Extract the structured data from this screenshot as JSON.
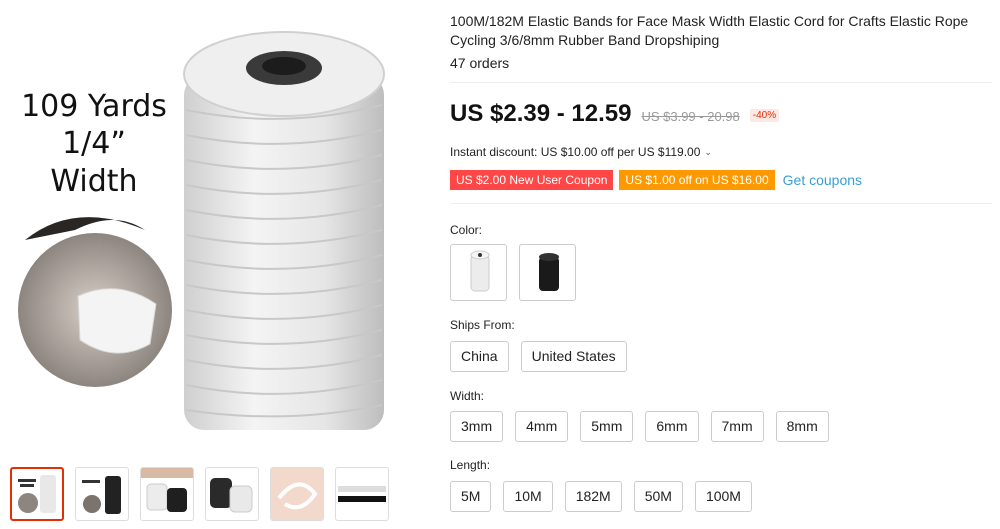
{
  "gallery": {
    "overlay_line1": "109 Yards",
    "overlay_line2": "1/4”  Width",
    "thumbnails": [
      "thumb-1",
      "thumb-2",
      "thumb-3",
      "thumb-4",
      "thumb-5",
      "thumb-6"
    ]
  },
  "product": {
    "title": "100M/182M Elastic Bands for Face Mask Width Elastic Cord for Crafts Elastic Rope Cycling 3/6/8mm Rubber Band Dropshiping",
    "orders": "47 orders"
  },
  "price": {
    "current": "US $2.39 - 12.59",
    "original": "US $3.99 - 20.98",
    "discount": "-40%"
  },
  "instant_discount": {
    "text": "Instant discount: US $10.00 off per US $119.00",
    "chevron": "⌄"
  },
  "coupons": {
    "new_user": "US $2.00 New User Coupon",
    "store": "US $1.00 off on US $16.00",
    "get_label": "Get coupons"
  },
  "color": {
    "label": "Color:",
    "options": [
      "white",
      "black"
    ]
  },
  "ships_from": {
    "label": "Ships From:",
    "options": [
      "China",
      "United States"
    ]
  },
  "width": {
    "label": "Width:",
    "options": [
      "3mm",
      "4mm",
      "5mm",
      "6mm",
      "7mm",
      "8mm"
    ]
  },
  "length": {
    "label": "Length:",
    "options": [
      "5M",
      "10M",
      "182M",
      "50M",
      "100M"
    ]
  },
  "colors": {
    "accent_red": "#e62e04",
    "coupon_red": "#ff4747",
    "coupon_orange": "#ff9900",
    "link_blue": "#3a9dd6"
  }
}
